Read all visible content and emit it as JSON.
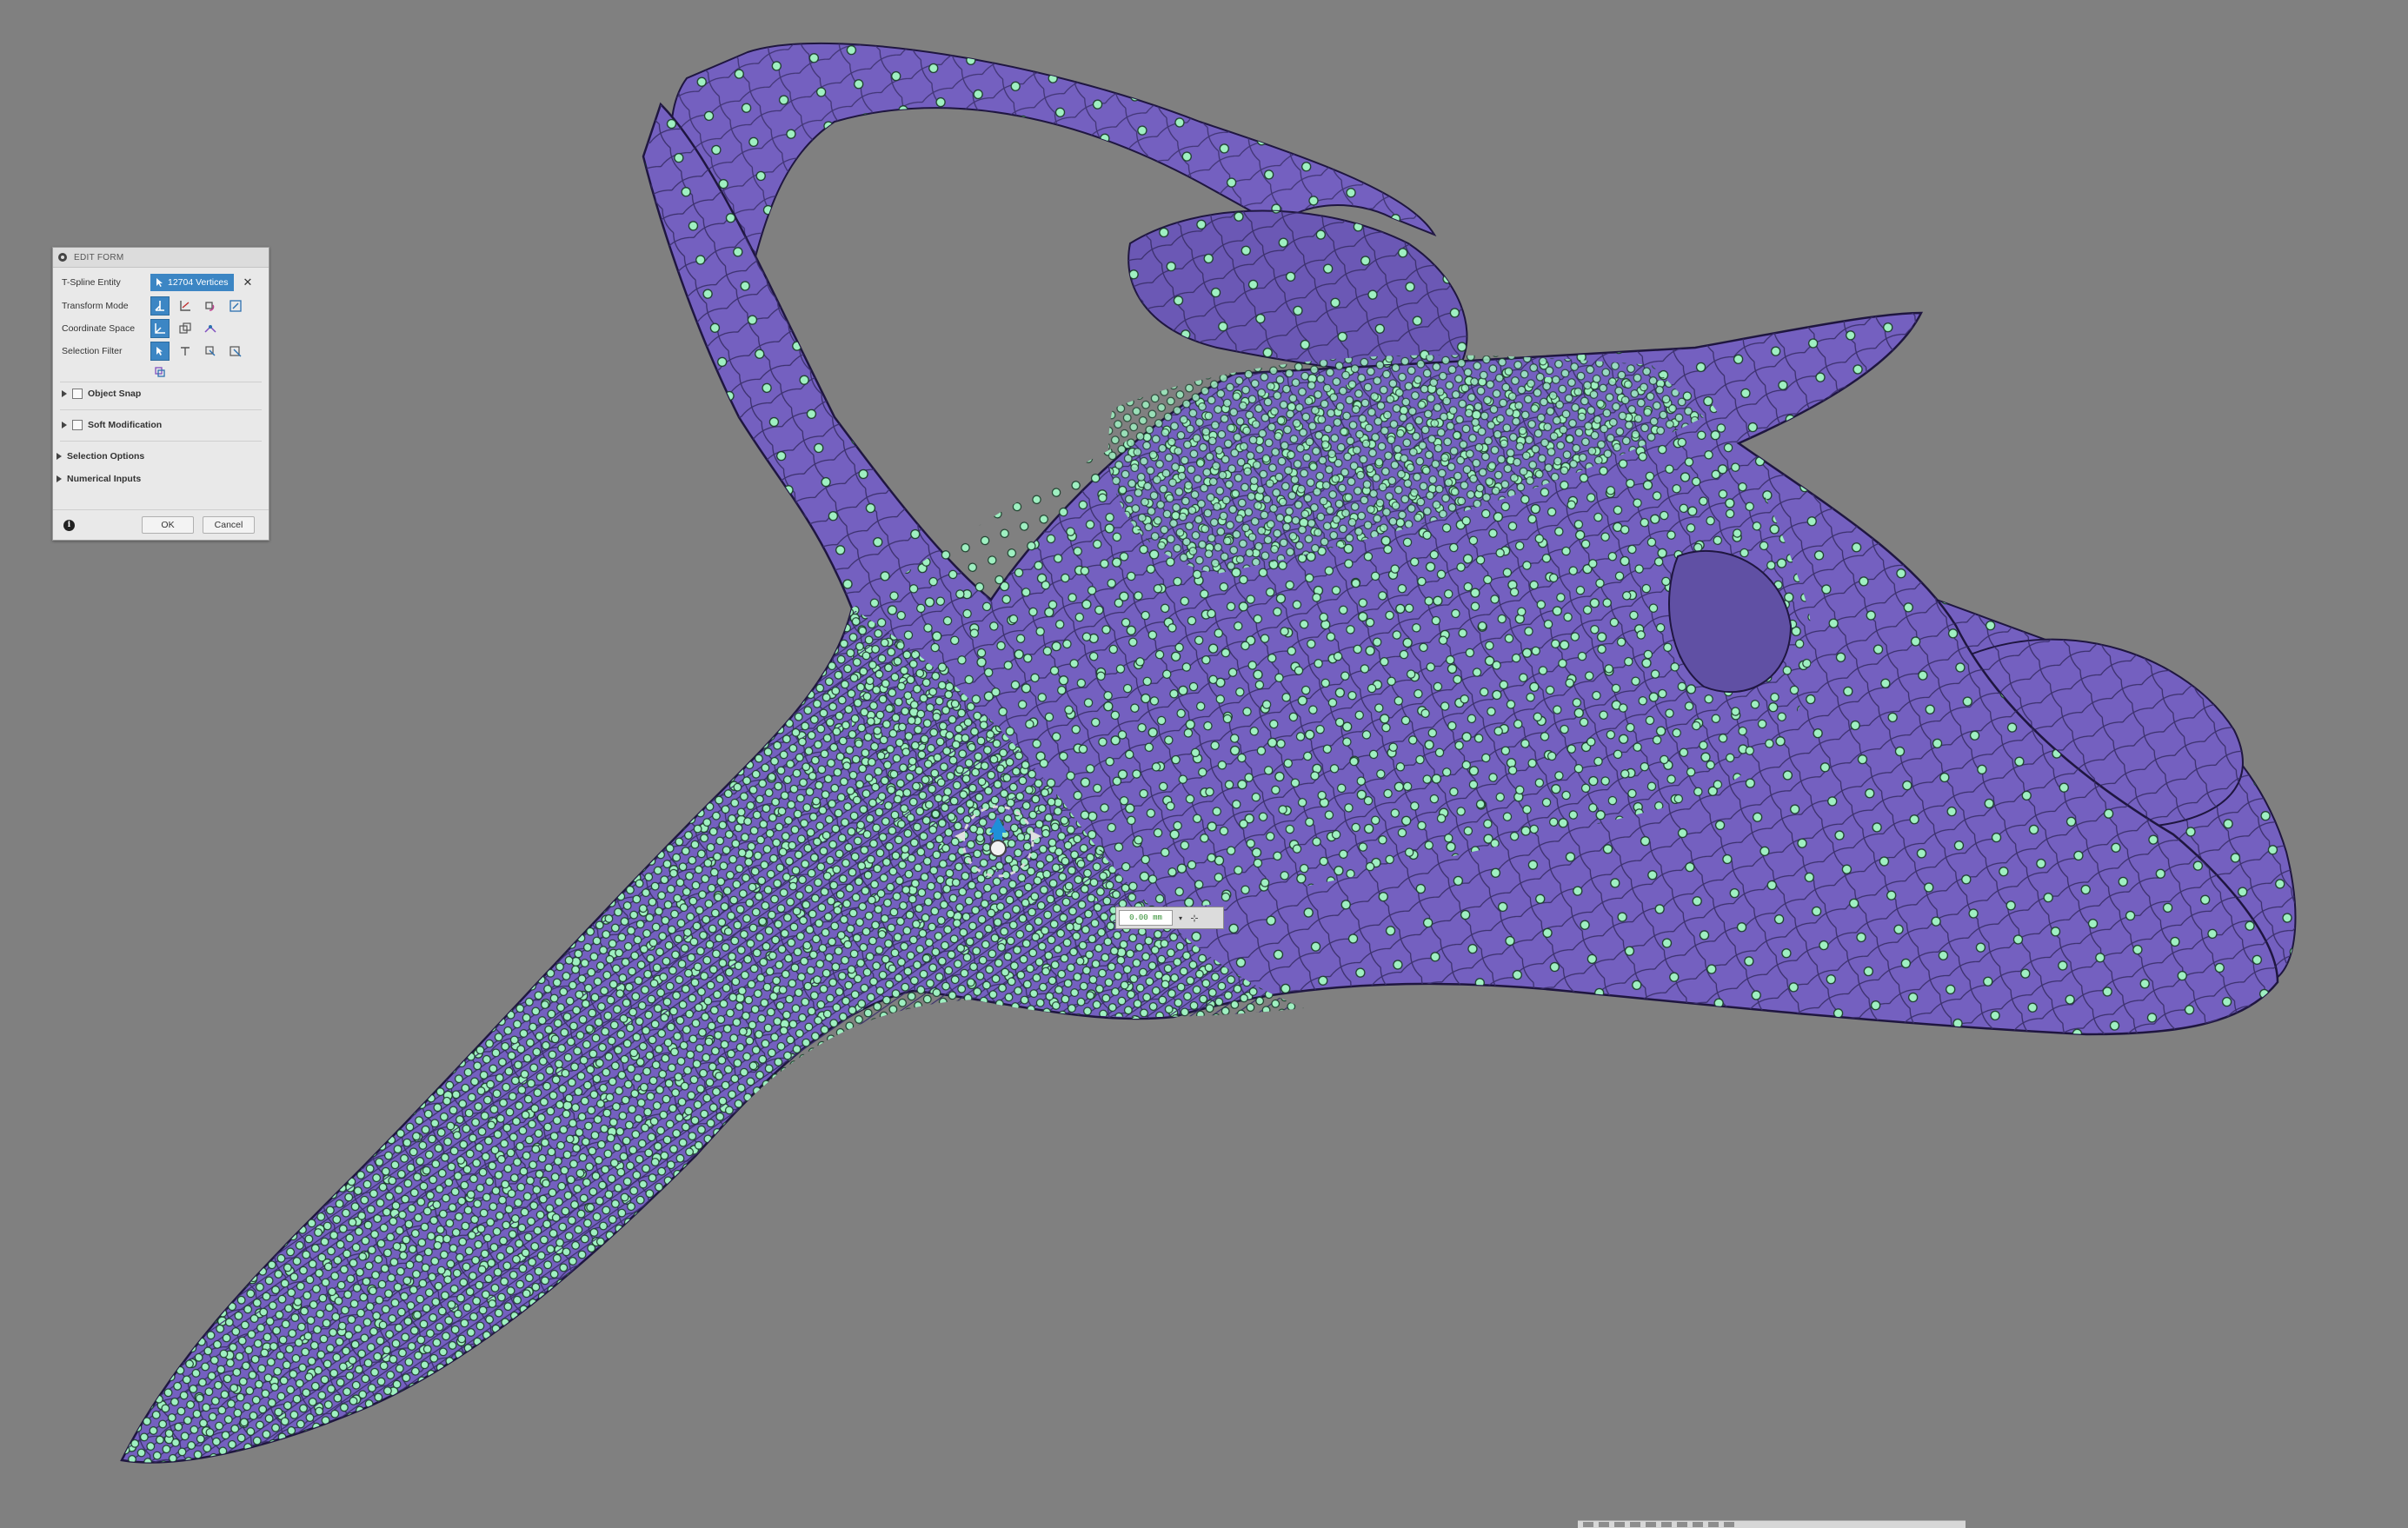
{
  "panel": {
    "title": "EDIT FORM",
    "rows": {
      "tspline_entity": {
        "label": "T-Spline Entity",
        "value": "12704 Vertices"
      },
      "transform_mode": {
        "label": "Transform Mode"
      },
      "coordinate_space": {
        "label": "Coordinate Space"
      },
      "selection_filter": {
        "label": "Selection Filter"
      }
    },
    "sections": {
      "object_snap": "Object Snap",
      "soft_modification": "Soft Modification",
      "selection_options": "Selection Options",
      "numerical_inputs": "Numerical Inputs"
    },
    "buttons": {
      "ok": "OK",
      "cancel": "Cancel"
    }
  },
  "manipulator": {
    "value": "0.00 mm"
  },
  "colors": {
    "background": "#808080",
    "surface": "#7460c0",
    "vertex": "#9ff0c2",
    "accent": "#3c86c4"
  },
  "icons": [
    "close-icon",
    "cursor-icon",
    "move-icon",
    "scale-icon",
    "rotate-icon",
    "coordinate-axes-icon",
    "vertex-select-icon",
    "edge-select-icon",
    "face-select-icon",
    "body-select-icon",
    "info-icon",
    "pin-icon"
  ]
}
